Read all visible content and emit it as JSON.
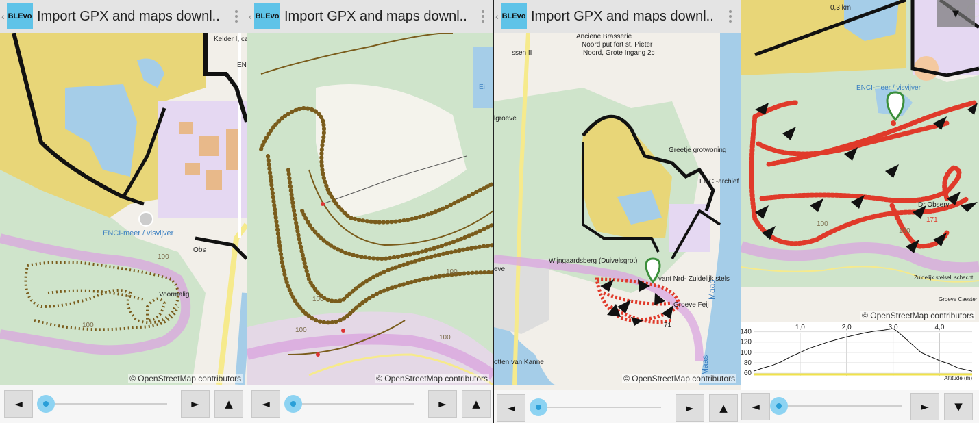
{
  "app": {
    "logo": "BLEvo",
    "title": "Import GPX and maps downl..",
    "back": "‹"
  },
  "map": {
    "attribution": "© OpenStreetMap contributors",
    "colors": {
      "park": "#e8d678",
      "forest": "#cfe4cb",
      "water": "#a5cde8",
      "industrial": "#e5d8f2",
      "track": "#7a5c1c",
      "route": "#e03a2a",
      "border": "#d9a6df",
      "road": "#f6ea8c"
    }
  },
  "screens": [
    {
      "labels": {
        "lake": "ENCI-meer / visvijver",
        "obs": "Obs",
        "voormalig": "Voormalig",
        "kelder": "Kelder I, casi",
        "enc": "ENC",
        "c100a": "100",
        "c100b": "100"
      },
      "controls": {
        "prev": "◄",
        "next": "►",
        "up": "▲"
      },
      "slider_position": 0.0
    },
    {
      "labels": {
        "ei": "Ei",
        "c100a": "100",
        "c100b": "100",
        "c100c": "100",
        "c100d": "100"
      },
      "controls": {
        "prev": "◄",
        "next": "►",
        "up": "▲"
      },
      "slider_position": 0.0
    },
    {
      "labels": {
        "brasserie1": "Anciene Brasserie",
        "brasserie2": "Noord put fort st. Pieter",
        "brasserie3": "Noord, Grote Ingang 2c",
        "ssen": "ssen II",
        "lgroeve": "lgroeve",
        "greetje": "Greetje grotwoning",
        "enciarchief": "ENCI-archief",
        "wijngaard": "Wijngaardsberg (Duivelsgrot)",
        "zuidelijk": "vant Nrd- Zuidelijk stels",
        "groeve": "Groeve Feij",
        "eve": "eve",
        "maas1": "Maas",
        "maas2": "Maas",
        "kanne": "otten van Kanne",
        "n71": "71"
      },
      "controls": {
        "prev": "◄",
        "next": "►",
        "up": "▲"
      },
      "slider_position": 0.0
    },
    {
      "labels": {
        "scale": "0,3 km",
        "lake": "ENCI-meer / visvijver",
        "observ": "Dr Observ",
        "n171": "171",
        "c100a": "100",
        "c100b": "100",
        "zuidelijk": "Zuidelijk stelsel, schacht",
        "groeve": "Groeve Caester"
      },
      "overlay_button": "▼",
      "controls": {
        "prev": "◄",
        "next": "►",
        "down": "▼"
      },
      "slider_position": 0.0,
      "elevation": {
        "x_ticks": [
          "1,0",
          "2,0",
          "3,0",
          "4,0"
        ],
        "y_ticks": [
          "140",
          "120",
          "100",
          "80",
          "60"
        ],
        "legend": "Altitude (m)"
      }
    }
  ],
  "chart_data": {
    "type": "line",
    "title": "",
    "xlabel": "",
    "ylabel": "Altitude (m)",
    "xlim": [
      0,
      4.7
    ],
    "ylim": [
      55,
      150
    ],
    "series": [
      {
        "name": "Altitude (m)",
        "x": [
          0,
          0.2,
          0.4,
          0.6,
          0.8,
          1.0,
          1.2,
          1.4,
          1.6,
          1.8,
          2.0,
          2.2,
          2.4,
          2.6,
          2.8,
          3.0,
          3.1,
          3.2,
          3.4,
          3.6,
          3.8,
          4.0,
          4.2,
          4.4,
          4.6,
          4.7
        ],
        "y": [
          64,
          70,
          75,
          82,
          92,
          100,
          108,
          114,
          120,
          125,
          130,
          134,
          138,
          141,
          143,
          146,
          140,
          132,
          116,
          100,
          92,
          84,
          78,
          70,
          66,
          64
        ]
      }
    ]
  }
}
